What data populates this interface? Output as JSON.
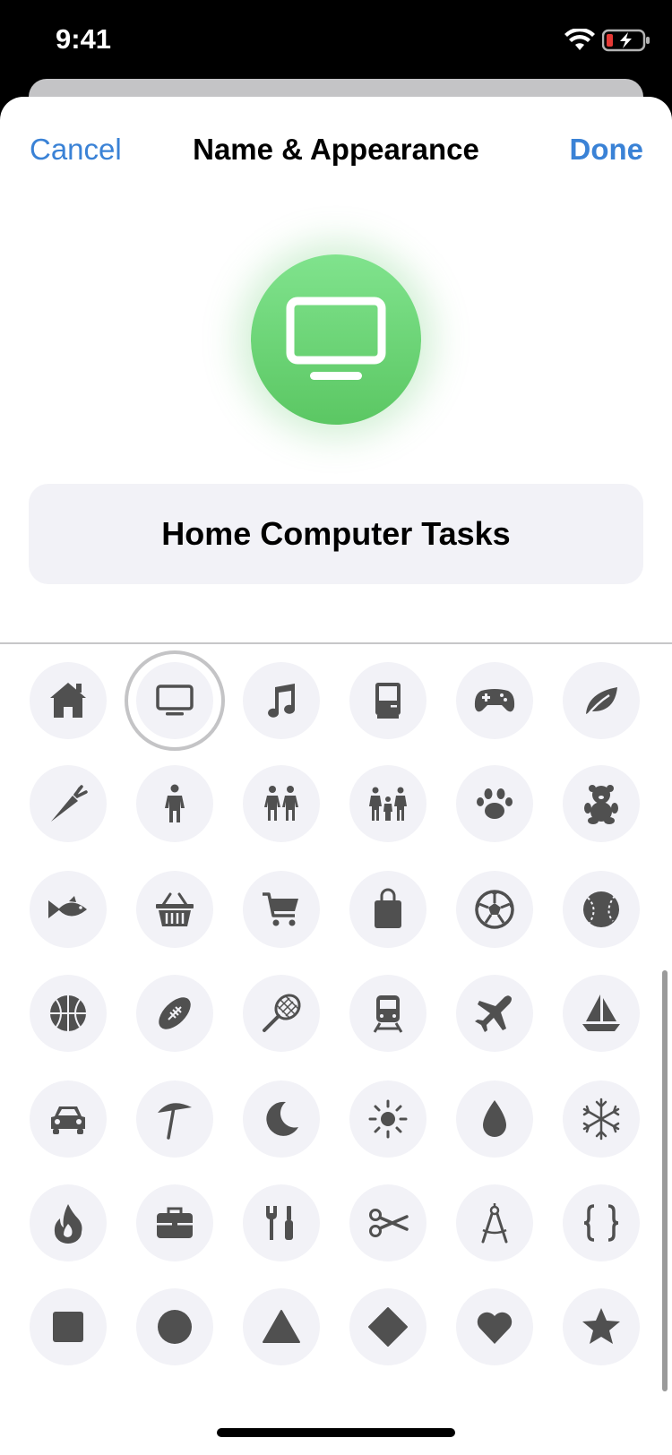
{
  "status_bar": {
    "time": "9:41"
  },
  "nav": {
    "cancel_label": "Cancel",
    "title": "Name & Appearance",
    "done_label": "Done"
  },
  "list_icon": {
    "symbol": "desktop-computer-icon",
    "color": "#62c86a"
  },
  "name_field": {
    "value": "Home Computer Tasks"
  },
  "icon_picker": {
    "selected": "desktop-computer-icon",
    "icons": [
      "house-icon",
      "desktop-computer-icon",
      "music-note-icon",
      "classic-computer-icon",
      "game-controller-icon",
      "leaf-icon",
      "carrot-icon",
      "person-icon",
      "two-people-icon",
      "family-icon",
      "paw-icon",
      "teddy-bear-icon",
      "fish-icon",
      "basket-icon",
      "shopping-cart-icon",
      "shopping-bag-icon",
      "soccer-ball-icon",
      "baseball-icon",
      "basketball-icon",
      "football-icon",
      "tennis-racket-icon",
      "train-icon",
      "airplane-icon",
      "sailboat-icon",
      "car-icon",
      "beach-umbrella-icon",
      "moon-icon",
      "sun-icon",
      "drop-icon",
      "snowflake-icon",
      "flame-icon",
      "briefcase-icon",
      "tools-icon",
      "scissors-icon",
      "compass-icon",
      "braces-icon",
      "square-icon",
      "circle-icon",
      "triangle-icon",
      "diamond-icon",
      "heart-icon",
      "star-icon"
    ]
  },
  "colors": {
    "accent": "#3a82d6",
    "icon_fill": "#505050",
    "cell_bg": "#f2f2f7",
    "battery_low": "#e53935"
  }
}
